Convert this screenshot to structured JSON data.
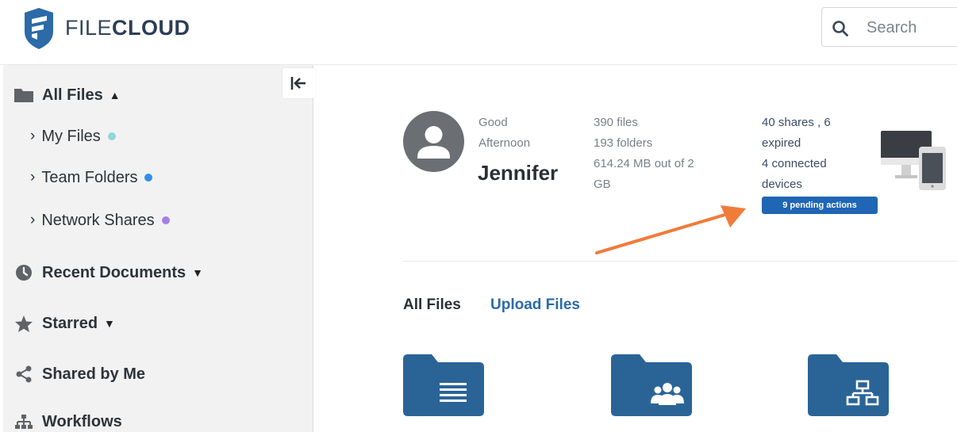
{
  "header": {
    "brand_part1": "FILE",
    "brand_part2": "CLOUD",
    "search_placeholder": "Search"
  },
  "sidebar": {
    "all_files": "All Files",
    "sub_items": [
      {
        "label": "My Files",
        "dot_color": "#8fd8d8"
      },
      {
        "label": "Team Folders",
        "dot_color": "#2f8fe8"
      },
      {
        "label": "Network Shares",
        "dot_color": "#a67de8"
      }
    ],
    "recent_documents": "Recent Documents",
    "starred": "Starred",
    "shared_by_me": "Shared by Me",
    "workflows": "Workflows"
  },
  "dashboard": {
    "greeting_line1": "Good",
    "greeting_line2": "Afternoon",
    "user_name": "Jennifer",
    "files": "390 files",
    "folders": "193 folders",
    "storage_line1": "614.24 MB out of 2",
    "storage_line2": "GB",
    "shares_line1": "40 shares , 6",
    "shares_line2": "expired",
    "devices_line1": "4 connected",
    "devices_line2": "devices",
    "pending_actions": "9 pending actions"
  },
  "tabs": {
    "all_files": "All Files",
    "upload_files": "Upload Files"
  },
  "colors": {
    "accent": "#1f66b4",
    "folder": "#2a6497",
    "arrow": "#f07c3a"
  }
}
